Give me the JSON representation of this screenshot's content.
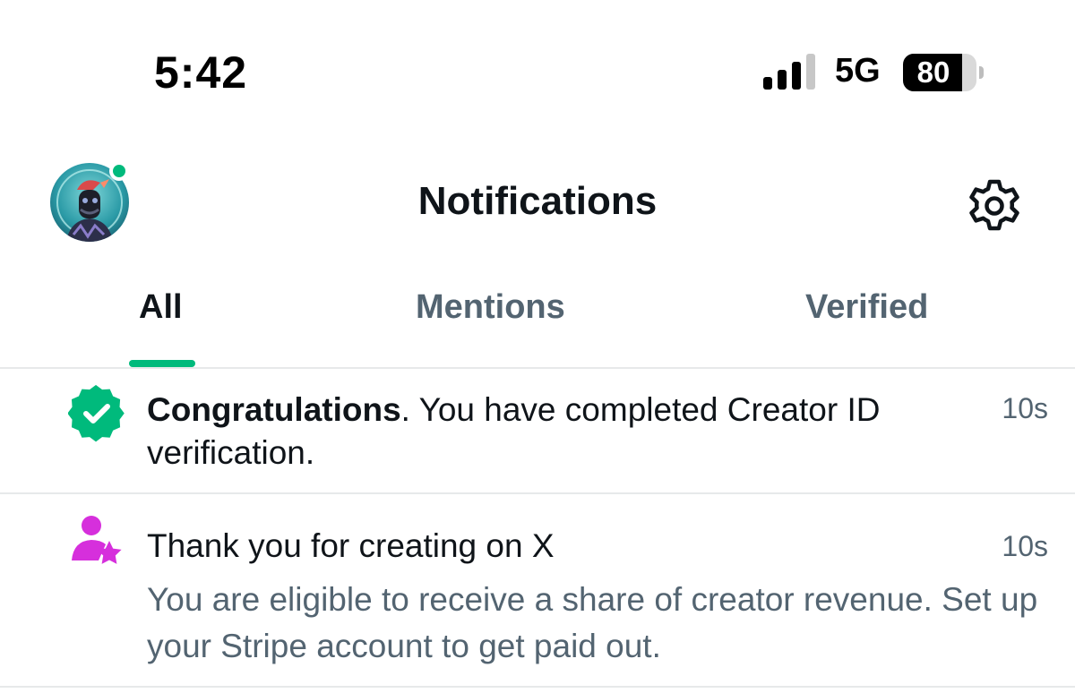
{
  "status_bar": {
    "time": "5:42",
    "network": "5G",
    "battery": "80",
    "battery_level": 0.8
  },
  "header": {
    "title": "Notifications",
    "avatar_icon": "avatar-image",
    "settings_icon": "gear-icon"
  },
  "tabs": [
    {
      "label": "All",
      "active": true
    },
    {
      "label": "Mentions",
      "active": false
    },
    {
      "label": "Verified",
      "active": false
    }
  ],
  "notifications": [
    {
      "icon": "verified-badge-icon",
      "icon_color": "#00ba7c",
      "title": "Congratulations",
      "text": ".  You have completed Creator ID verification.",
      "time": "10s"
    },
    {
      "icon": "creator-star-icon",
      "icon_color": "#d62fdc",
      "title": "Thank you for creating on X",
      "subtitle": "You are eligible to receive a share of creator revenue. Set up your Stripe account to get paid out.",
      "time": "10s"
    }
  ],
  "colors": {
    "accent": "#00ba7c",
    "secondary_text": "#536471",
    "primary_text": "#0f1419",
    "divider": "#e7e9ea"
  }
}
